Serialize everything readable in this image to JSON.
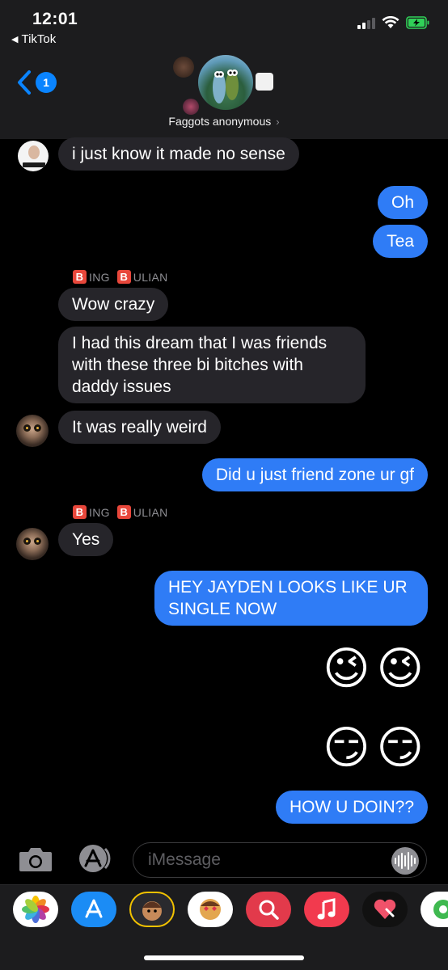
{
  "status_bar": {
    "time": "12:01",
    "back_app": "TikTok"
  },
  "nav": {
    "unread_count": "1",
    "group_name": "Faggots anonymous",
    "chevron": "›"
  },
  "messages": [
    {
      "direction": "in",
      "text": "i just know it made no sense"
    },
    {
      "direction": "out",
      "text": "Oh"
    },
    {
      "direction": "out",
      "text": "Tea"
    },
    {
      "direction": "in",
      "sender": "ING ULIAN",
      "text": "Wow crazy"
    },
    {
      "direction": "in",
      "text": "I had this dream that I was friends with these three bi bitches with daddy issues"
    },
    {
      "direction": "in",
      "text": "It was really weird"
    },
    {
      "direction": "out",
      "text": "Did u just friend zone ur gf"
    },
    {
      "direction": "in",
      "sender": "ING ULIAN",
      "text": "Yes"
    },
    {
      "direction": "out",
      "text": "HEY JAYDEN LOOKS LIKE UR SINGLE NOW"
    },
    {
      "direction": "out",
      "text": "😉 😉"
    },
    {
      "direction": "out",
      "text": "😏 😏"
    },
    {
      "direction": "out",
      "text": "HOW U DOIN??"
    }
  ],
  "sender_tag": {
    "first_letter": "B",
    "first_rest": "ING",
    "second_letter": "B",
    "second_rest": "ULIAN"
  },
  "emojis": {
    "wink": "😉",
    "smirk": "😏"
  },
  "input": {
    "placeholder": "iMessage"
  },
  "apps": [
    {
      "name": "photos-icon"
    },
    {
      "name": "app-store-icon"
    },
    {
      "name": "memoji-icon"
    },
    {
      "name": "memoji-stickers-icon"
    },
    {
      "name": "web-search-icon"
    },
    {
      "name": "music-icon"
    },
    {
      "name": "digital-touch-icon"
    },
    {
      "name": "more-apps-icon"
    }
  ],
  "colors": {
    "outgoing_bubble": "#2f7cf6",
    "incoming_bubble": "#26252a",
    "accent": "#0a84ff",
    "background": "#000000"
  }
}
